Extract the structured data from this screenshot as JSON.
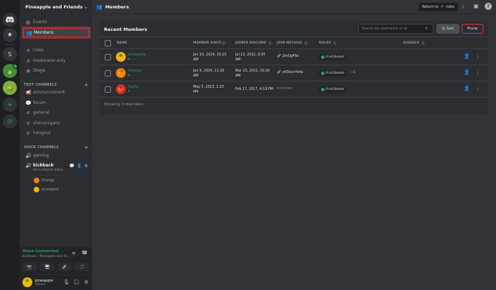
{
  "colors": {
    "accent_green": "#23a55a",
    "danger_red": "#da373c",
    "active_highlight": "#e03131",
    "mac_close": "#ff5f57",
    "mac_min": "#febc2e",
    "mac_max": "#28c840"
  },
  "server_rail": {
    "items": [
      {
        "name": "discord-home",
        "icon": "discord-logo-icon"
      },
      {
        "name": "starred",
        "icon": "star-icon"
      },
      {
        "name": "server-s",
        "label": "S"
      },
      {
        "name": "server-pineapple",
        "icon": "pineapple-icon"
      },
      {
        "name": "server-kiwi",
        "icon": "kiwi-icon"
      },
      {
        "name": "add-server",
        "icon": "plus-icon"
      },
      {
        "name": "discover",
        "icon": "compass-icon"
      }
    ]
  },
  "sidebar": {
    "guild_name": "Pineapple and Friends",
    "top_items": [
      {
        "label": "Events",
        "icon": "calendar-icon"
      },
      {
        "label": "Members",
        "icon": "members-icon",
        "active": true
      }
    ],
    "channels": [
      {
        "label": "rules",
        "icon": "#"
      },
      {
        "label": "moderator-only",
        "icon": "#"
      },
      {
        "label": "Stage",
        "icon": "stage-icon"
      }
    ],
    "text_category": "TEXT CHANNELS",
    "text_channels": [
      {
        "label": "announcement",
        "icon": "megaphone-icon"
      },
      {
        "label": "forum",
        "icon": "forum-icon"
      },
      {
        "label": "general",
        "icon": "#"
      },
      {
        "label": "shenanigans",
        "icon": "#"
      },
      {
        "label": "hangout",
        "icon": "#"
      }
    ],
    "voice_category": "VOICE CHANNELS",
    "voice_channels": [
      {
        "label": "gaming"
      },
      {
        "label": "kickback",
        "status": "Set a channel status",
        "active": true
      }
    ],
    "voice_users": [
      {
        "name": "Orange"
      },
      {
        "name": "pineapple"
      }
    ],
    "voice_panel": {
      "status": "Voice Connected",
      "location": "kickback / Pineapple and Fri..."
    },
    "user_panel": {
      "username": "pineapple",
      "status": "Online"
    }
  },
  "topbar": {
    "title": "Members",
    "return_label": "Return to",
    "return_target": "rules"
  },
  "members": {
    "title": "Recent Members",
    "search_placeholder": "Search by username or id",
    "sort_label": "Sort",
    "prune_label": "Prune",
    "columns": [
      "NAME",
      "MEMBER SINCE",
      "JOINED DISCORD",
      "JOIN METHOD",
      "ROLES",
      "SIGNALS"
    ],
    "rows": [
      {
        "name": "pineapple",
        "sub": "p...",
        "avatar_color": "#f4b400",
        "member_since": "Jan 10, 2024, 10:23",
        "member_since2": "AM",
        "joined_discord": "Jul 13, 2022, 9:35",
        "joined_discord2": "AM",
        "join_method": "ZmOpF9x",
        "role": "Fruit Basket",
        "extra_roles": ""
      },
      {
        "name": "Orange",
        "sub": "p...",
        "avatar_color": "#f57c00",
        "member_since": "Jan 4, 2024, 11:26",
        "member_since2": "AM",
        "joined_discord": "Mar 23, 2021, 10:30",
        "joined_discord2": "AM",
        "join_method": "zVDevnYo4a",
        "role": "Fruit Basket",
        "extra_roles": "+1"
      },
      {
        "name": "Apple",
        "sub": "k...",
        "avatar_color": "#d32f2f",
        "member_since": "May 5, 2023, 1:23",
        "member_since2": "PM",
        "joined_discord": "Feb 17, 2017, 4:19 PM",
        "joined_discord2": "",
        "join_method": "Unknown",
        "role": "Fruit Basket",
        "extra_roles": ""
      }
    ],
    "footer": "Showing 3 members"
  }
}
